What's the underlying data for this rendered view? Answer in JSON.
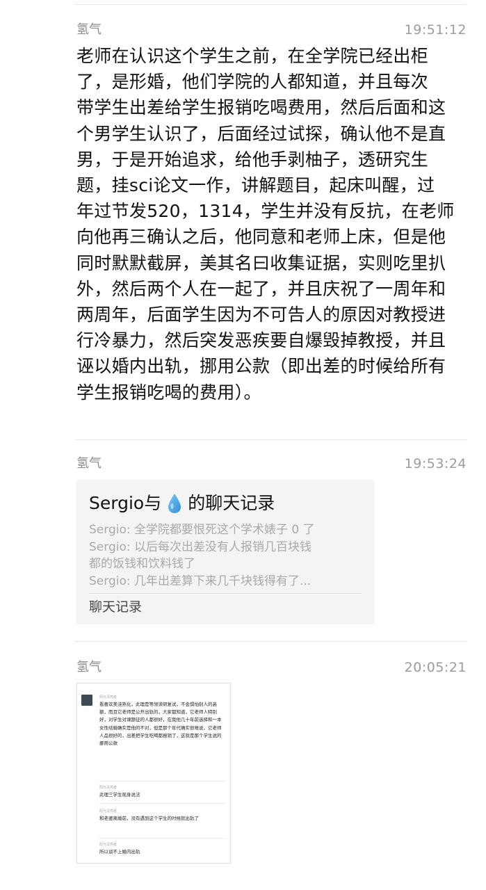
{
  "messages": [
    {
      "sender": "氢气",
      "time": "19:51:12",
      "text": "老师在认识这个学生之前，在全学院已经出柜\n了，是形婚，他们学院的人都知道，并且每次\n带学生出差给学生报销吃喝费用，然后后面和这\n个男学生认识了，后面经过试探，确认他不是直\n男，于是开始追求，给他手剥柚子，透研究生\n题，挂sci论文一作，讲解题目，起床叫醒，过\n年过节发520，1314，学生并没有反抗，在老师\n向他再三确认之后，他同意和老师上床，但是他\n同时默默截屏，美其名曰收集证据，实则吃里扒\n外，然后两个人在一起了，并且庆祝了一周年和\n两周年，后面学生因为不可告人的原因对教授进\n行冷暴力，然后突发恶疾要自爆毁掉教授，并且\n诬以婚内出轨，挪用公款（即出差的时候给所有\n学生报销吃喝的费用）。"
    },
    {
      "sender": "氢气",
      "time": "19:53:24",
      "card": {
        "title_prefix": "Sergio与",
        "title_icon": "water-drop-icon",
        "title_suffix": "的聊天记录",
        "lines": [
          "Sergio: 全学院都要恨死这个学术婊子 0 了",
          "Sergio: 以后每次出差没有人报销几百块钱\n都的饭钱和饮料钱了",
          "Sergio: 几年出差算下来几千块钱得有了..."
        ],
        "footer": "聊天记录"
      }
    },
    {
      "sender": "氢气",
      "time": "20:05:21",
      "thumbnail": {
        "items": [
          {
            "name": "阳光清亮者",
            "body": "看喜欢美洼熟化，此理是等领读研复试，不会惧怕别人的高额，而且它老师是公开出轨的，大家都知道，它老师人特别好，对学生对课题征的人都很好，在我他几十年前选择和一本女性结婚确实是他的不对，但是那个年代确实很难说，它老师人品很好的，出差把学生吃喝都报销了，这就是那个学生说的挪用公款"
          },
          {
            "name": "阳光清亮者",
            "body": "此理三学生现身说法"
          },
          {
            "name": "阳光清亮者",
            "body": "和老婆离婚前，没有遇到这个学生的时候就出轨了"
          },
          {
            "name": "阳光清亮者",
            "body": "所以谈不上婚内出轨"
          }
        ]
      }
    }
  ],
  "colors": {
    "text": "#111111",
    "meta": "#8a8a8a",
    "card_bg": "#f4f4f4",
    "drop_icon": "#4aa8e6"
  }
}
